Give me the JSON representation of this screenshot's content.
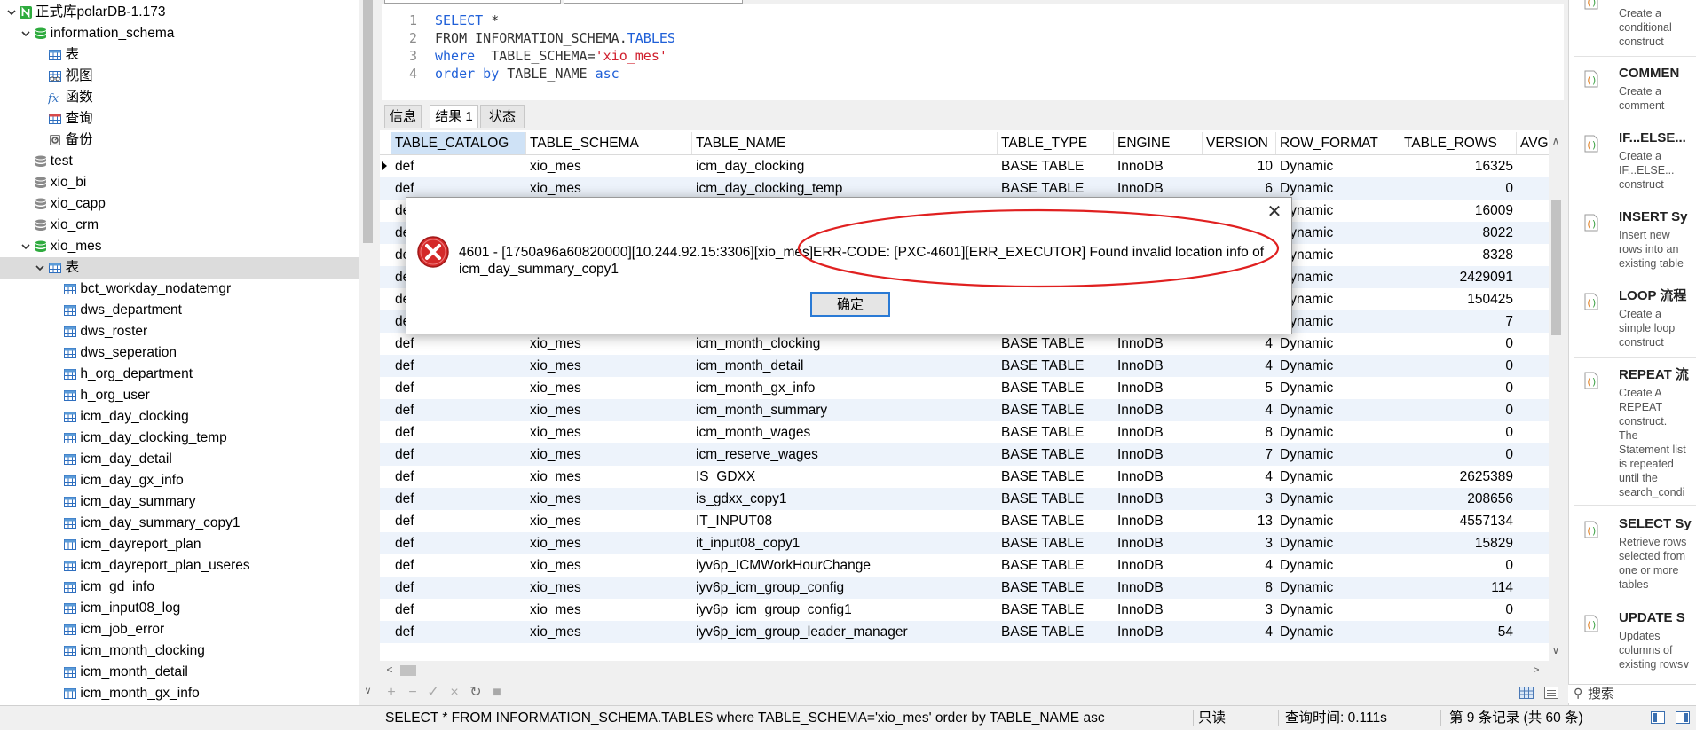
{
  "tree": {
    "items": [
      {
        "level": 0,
        "toggle": "expanded",
        "icon": "connection-icon",
        "label": "正式库polarDB-1.173"
      },
      {
        "level": 1,
        "toggle": "expanded",
        "icon": "database-open-icon",
        "label": "information_schema"
      },
      {
        "level": 2,
        "icon": "table-icon",
        "label": "表"
      },
      {
        "level": 2,
        "icon": "view-icon",
        "label": "视图"
      },
      {
        "level": 2,
        "icon": "function-icon",
        "label": "函数"
      },
      {
        "level": 2,
        "icon": "query-icon",
        "label": "查询"
      },
      {
        "level": 2,
        "icon": "backup-icon",
        "label": "备份"
      },
      {
        "level": 1,
        "icon": "database-icon",
        "label": "test"
      },
      {
        "level": 1,
        "icon": "database-icon",
        "label": "xio_bi"
      },
      {
        "level": 1,
        "icon": "database-icon",
        "label": "xio_capp"
      },
      {
        "level": 1,
        "icon": "database-icon",
        "label": "xio_crm"
      },
      {
        "level": 1,
        "toggle": "expanded",
        "icon": "database-open-icon",
        "label": "xio_mes"
      },
      {
        "level": 2,
        "toggle": "expanded",
        "icon": "table-icon",
        "label": "表",
        "selected": true
      },
      {
        "level": 3,
        "icon": "table-icon",
        "label": "bct_workday_nodatemgr"
      },
      {
        "level": 3,
        "icon": "table-icon",
        "label": "dws_department"
      },
      {
        "level": 3,
        "icon": "table-icon",
        "label": "dws_roster"
      },
      {
        "level": 3,
        "icon": "table-icon",
        "label": "dws_seperation"
      },
      {
        "level": 3,
        "icon": "table-icon",
        "label": "h_org_department"
      },
      {
        "level": 3,
        "icon": "table-icon",
        "label": "h_org_user"
      },
      {
        "level": 3,
        "icon": "table-icon",
        "label": "icm_day_clocking"
      },
      {
        "level": 3,
        "icon": "table-icon",
        "label": "icm_day_clocking_temp"
      },
      {
        "level": 3,
        "icon": "table-icon",
        "label": "icm_day_detail"
      },
      {
        "level": 3,
        "icon": "table-icon",
        "label": "icm_day_gx_info"
      },
      {
        "level": 3,
        "icon": "table-icon",
        "label": "icm_day_summary"
      },
      {
        "level": 3,
        "icon": "table-icon",
        "label": "icm_day_summary_copy1"
      },
      {
        "level": 3,
        "icon": "table-icon",
        "label": "icm_dayreport_plan"
      },
      {
        "level": 3,
        "icon": "table-icon",
        "label": "icm_dayreport_plan_useres"
      },
      {
        "level": 3,
        "icon": "table-icon",
        "label": "icm_gd_info"
      },
      {
        "level": 3,
        "icon": "table-icon",
        "label": "icm_input08_log"
      },
      {
        "level": 3,
        "icon": "table-icon",
        "label": "icm_job_error"
      },
      {
        "level": 3,
        "icon": "table-icon",
        "label": "icm_month_clocking"
      },
      {
        "level": 3,
        "icon": "table-icon",
        "label": "icm_month_detail"
      },
      {
        "level": 3,
        "icon": "table-icon",
        "label": "icm_month_gx_info"
      }
    ]
  },
  "editor": {
    "lines": [
      {
        "num": "1",
        "tokens": [
          {
            "t": "kw",
            "text": "SELECT"
          },
          {
            "t": "plain",
            "text": " *"
          }
        ]
      },
      {
        "num": "2",
        "tokens": [
          {
            "t": "plain",
            "text": "FROM INFORMATION_SCHEMA."
          },
          {
            "t": "kw",
            "text": "TABLES"
          }
        ]
      },
      {
        "num": "3",
        "tokens": [
          {
            "t": "kw",
            "text": "where"
          },
          {
            "t": "plain",
            "text": "  TABLE_SCHEMA="
          },
          {
            "t": "str",
            "text": "'xio_mes'"
          }
        ]
      },
      {
        "num": "4",
        "tokens": [
          {
            "t": "kw",
            "text": "order by"
          },
          {
            "t": "plain",
            "text": " TABLE_NAME "
          },
          {
            "t": "kw",
            "text": "asc"
          }
        ]
      }
    ]
  },
  "result_tabs": {
    "items": [
      "信息",
      "结果 1",
      "状态"
    ],
    "active": 1
  },
  "grid": {
    "columns": [
      "TABLE_CATALOG",
      "TABLE_SCHEMA",
      "TABLE_NAME",
      "TABLE_TYPE",
      "ENGINE",
      "VERSION",
      "ROW_FORMAT",
      "TABLE_ROWS",
      "AVG"
    ],
    "sorted_column": 0,
    "current_row": 0,
    "rows": [
      [
        "def",
        "xio_mes",
        "icm_day_clocking",
        "BASE TABLE",
        "InnoDB",
        "10",
        "Dynamic",
        "16325"
      ],
      [
        "def",
        "xio_mes",
        "icm_day_clocking_temp",
        "BASE TABLE",
        "InnoDB",
        "6",
        "Dynamic",
        "0"
      ],
      [
        "def",
        "",
        "",
        "",
        "",
        "",
        "Dynamic",
        "16009"
      ],
      [
        "def",
        "",
        "",
        "",
        "",
        "",
        "Dynamic",
        "8022"
      ],
      [
        "def",
        "",
        "",
        "",
        "",
        "",
        "Dynamic",
        "8328"
      ],
      [
        "def",
        "",
        "",
        "",
        "",
        "",
        "Dynamic",
        "2429091"
      ],
      [
        "def",
        "",
        "",
        "",
        "",
        "",
        "Dynamic",
        "150425"
      ],
      [
        "def",
        "",
        "",
        "",
        "",
        "",
        "Dynamic",
        "7"
      ],
      [
        "def",
        "xio_mes",
        "icm_month_clocking",
        "BASE TABLE",
        "InnoDB",
        "4",
        "Dynamic",
        "0"
      ],
      [
        "def",
        "xio_mes",
        "icm_month_detail",
        "BASE TABLE",
        "InnoDB",
        "4",
        "Dynamic",
        "0"
      ],
      [
        "def",
        "xio_mes",
        "icm_month_gx_info",
        "BASE TABLE",
        "InnoDB",
        "5",
        "Dynamic",
        "0"
      ],
      [
        "def",
        "xio_mes",
        "icm_month_summary",
        "BASE TABLE",
        "InnoDB",
        "4",
        "Dynamic",
        "0"
      ],
      [
        "def",
        "xio_mes",
        "icm_month_wages",
        "BASE TABLE",
        "InnoDB",
        "8",
        "Dynamic",
        "0"
      ],
      [
        "def",
        "xio_mes",
        "icm_reserve_wages",
        "BASE TABLE",
        "InnoDB",
        "7",
        "Dynamic",
        "0"
      ],
      [
        "def",
        "xio_mes",
        "IS_GDXX",
        "BASE TABLE",
        "InnoDB",
        "4",
        "Dynamic",
        "2625389"
      ],
      [
        "def",
        "xio_mes",
        "is_gdxx_copy1",
        "BASE TABLE",
        "InnoDB",
        "3",
        "Dynamic",
        "208656"
      ],
      [
        "def",
        "xio_mes",
        "IT_INPUT08",
        "BASE TABLE",
        "InnoDB",
        "13",
        "Dynamic",
        "4557134"
      ],
      [
        "def",
        "xio_mes",
        "it_input08_copy1",
        "BASE TABLE",
        "InnoDB",
        "3",
        "Dynamic",
        "15829"
      ],
      [
        "def",
        "xio_mes",
        "iyv6p_ICMWorkHourChange",
        "BASE TABLE",
        "InnoDB",
        "4",
        "Dynamic",
        "0"
      ],
      [
        "def",
        "xio_mes",
        "iyv6p_icm_group_config",
        "BASE TABLE",
        "InnoDB",
        "8",
        "Dynamic",
        "114"
      ],
      [
        "def",
        "xio_mes",
        "iyv6p_icm_group_config1",
        "BASE TABLE",
        "InnoDB",
        "3",
        "Dynamic",
        "0"
      ],
      [
        "def",
        "xio_mes",
        "iyv6p_icm_group_leader_manager",
        "BASE TABLE",
        "InnoDB",
        "4",
        "Dynamic",
        "54"
      ]
    ]
  },
  "toolbar": {
    "icons": [
      "add-record-icon",
      "delete-record-icon",
      "apply-icon",
      "discard-icon",
      "refresh-icon",
      "stop-icon"
    ]
  },
  "snippets": {
    "items": [
      {
        "title": "",
        "lines": [
          "Create a",
          "conditional",
          "construct"
        ]
      },
      {
        "title": "COMMEN",
        "lines": [
          "Create a",
          "comment"
        ]
      },
      {
        "title": "IF...ELSE...",
        "lines": [
          "Create a",
          "IF...ELSE...",
          "construct"
        ]
      },
      {
        "title": "INSERT Sy",
        "lines": [
          "Insert new",
          "rows into an",
          "existing table"
        ]
      },
      {
        "title": "LOOP 流程",
        "lines": [
          "Create a",
          "simple loop",
          "construct"
        ]
      },
      {
        "title": "REPEAT 流",
        "lines": [
          "Create A",
          "REPEAT",
          "construct.",
          "The",
          "Statement list",
          "is repeated",
          "until the",
          "search_condi"
        ]
      },
      {
        "title": "SELECT Sy",
        "lines": [
          "Retrieve rows",
          "selected from",
          "one or more",
          "tables"
        ]
      },
      {
        "title": "UPDATE S",
        "lines": [
          "Updates",
          "columns of",
          "existing rows"
        ]
      }
    ],
    "search_placeholder": "搜索"
  },
  "status": {
    "sql": "SELECT * FROM INFORMATION_SCHEMA.TABLES  where  TABLE_SCHEMA='xio_mes' order by TABLE_NAME asc",
    "mode": "只读",
    "query_time": "查询时间: 0.111s",
    "record": "第 9 条记录 (共 60 条)"
  },
  "dialog": {
    "message_lines": [
      "4601 - [1750a96a60820000][10.244.92.15:3306][xio_mes]ERR-CODE: [PXC-4601][ERR_EXECUTOR] Found invalid location info of",
      "icm_day_summary_copy1"
    ],
    "ok_label": "确定",
    "close_label": "✕",
    "highlight_color": "#e02020"
  },
  "colors": {
    "keyword": "#2060d8",
    "string": "#d0202e",
    "selection": "#dcdcdc",
    "alt_row": "#edf3fb",
    "accent": "#2a7ad5"
  }
}
